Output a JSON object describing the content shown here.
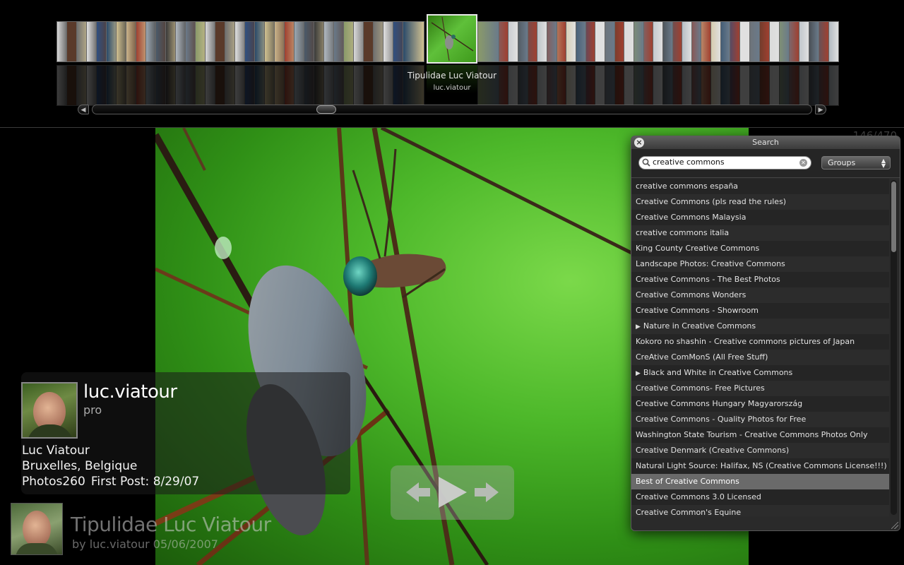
{
  "coverflow": {
    "selected_title": "Tipulidae Luc Viatour",
    "selected_user": "luc.viatour",
    "scroll_fraction": 0.32
  },
  "viewer": {
    "counter": "146/470",
    "author": {
      "username": "luc.viatour",
      "status": "pro",
      "real_name": "Luc Viatour",
      "location": "Bruxelles, Belgique",
      "photos": "Photos260",
      "first_post": "First Post: 8/29/07"
    },
    "photo_title": "Tipulidae Luc Viatour",
    "photo_byline": "by luc.viatour 05/06/2007",
    "controls": {
      "previous_icon": "arrow-left-icon",
      "play_icon": "play-icon",
      "next_icon": "arrow-right-icon"
    }
  },
  "search": {
    "window_title": "Search",
    "query": "creative commons",
    "scope": "Groups",
    "results": [
      {
        "label": "creative commons españa",
        "expandable": false
      },
      {
        "label": "Creative Commons (pls read the rules)",
        "expandable": false
      },
      {
        "label": "Creative Commons Malaysia",
        "expandable": false
      },
      {
        "label": "creative commons italia",
        "expandable": false
      },
      {
        "label": "King County Creative Commons",
        "expandable": false
      },
      {
        "label": "Landscape Photos: Creative Commons",
        "expandable": false
      },
      {
        "label": "Creative Commons - The Best Photos",
        "expandable": false
      },
      {
        "label": "Creative Commons Wonders",
        "expandable": false
      },
      {
        "label": "Creative Commons - Showroom",
        "expandable": false
      },
      {
        "label": "Nature in Creative Commons",
        "expandable": true
      },
      {
        "label": "Kokoro no shashin - Creative commons pictures of Japan",
        "expandable": false
      },
      {
        "label": "CreAtive ComMonS (All Free Stuff)",
        "expandable": false
      },
      {
        "label": "Black and White in Creative Commons",
        "expandable": true
      },
      {
        "label": "Creative Commons- Free Pictures",
        "expandable": false
      },
      {
        "label": "Creative Commons Hungary Magyarország",
        "expandable": false
      },
      {
        "label": "Creative Commons - Quality Photos for Free",
        "expandable": false
      },
      {
        "label": "Washington State Tourism - Creative Commons Photos Only",
        "expandable": false
      },
      {
        "label": "Creative Denmark (Creative Commons)",
        "expandable": false
      },
      {
        "label": "Natural Light Source: Halifax, NS (Creative Commons License!!!)",
        "expandable": false
      },
      {
        "label": "Best of Creative Commons",
        "expandable": false,
        "selected": true
      },
      {
        "label": "Creative Commons 3.0 Licensed",
        "expandable": false
      },
      {
        "label": "Creative Common's Equine",
        "expandable": false
      }
    ]
  },
  "colors": {
    "background": "#000000",
    "photo_green": "#4db82a",
    "selected_row": "#6a6a6a"
  }
}
